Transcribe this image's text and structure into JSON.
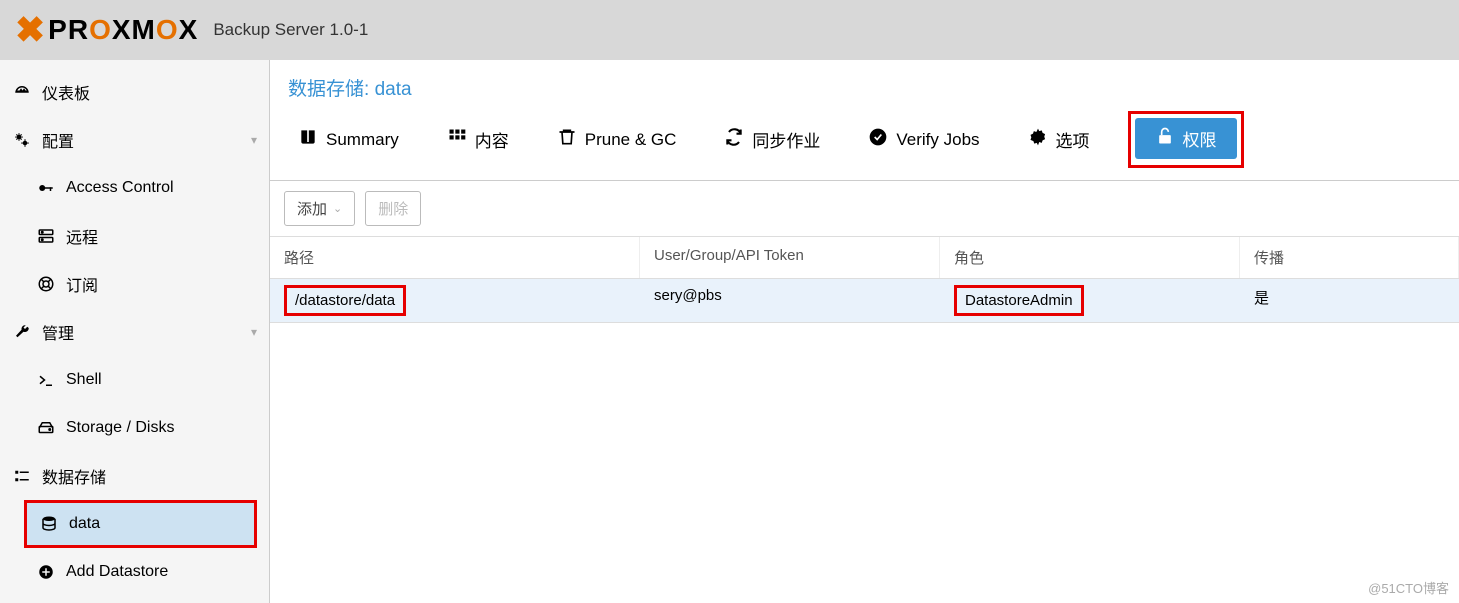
{
  "header": {
    "product": "PROXMOX",
    "subtitle": "Backup Server 1.0-1"
  },
  "sidebar": {
    "items": [
      {
        "label": "仪表板",
        "icon": "dashboard"
      },
      {
        "label": "配置",
        "icon": "gears",
        "expandable": true
      },
      {
        "label": "Access Control",
        "icon": "key",
        "sub": true
      },
      {
        "label": "远程",
        "icon": "server",
        "sub": true
      },
      {
        "label": "订阅",
        "icon": "lifebuoy",
        "sub": true
      },
      {
        "label": "管理",
        "icon": "wrench",
        "expandable": true
      },
      {
        "label": "Shell",
        "icon": "terminal",
        "sub": true
      },
      {
        "label": "Storage / Disks",
        "icon": "hdd",
        "sub": true
      },
      {
        "label": "数据存储",
        "icon": "list"
      },
      {
        "label": "data",
        "icon": "database",
        "sub": true,
        "selected": true,
        "highlight": true
      },
      {
        "label": "Add Datastore",
        "icon": "plus-circle",
        "sub": true
      }
    ]
  },
  "page": {
    "title_prefix": "数据存储: ",
    "title_name": "data"
  },
  "tabs": [
    {
      "label": "Summary",
      "icon": "book"
    },
    {
      "label": "内容",
      "icon": "grid"
    },
    {
      "label": "Prune & GC",
      "icon": "trash"
    },
    {
      "label": "同步作业",
      "icon": "sync"
    },
    {
      "label": "Verify Jobs",
      "icon": "check-circle"
    },
    {
      "label": "选项",
      "icon": "gear"
    },
    {
      "label": "权限",
      "icon": "unlock",
      "active": true,
      "highlight": true
    }
  ],
  "toolbar": {
    "add_label": "添加",
    "remove_label": "删除"
  },
  "table": {
    "columns": {
      "path": "路径",
      "user": "User/Group/API Token",
      "role": "角色",
      "propagate": "传播"
    },
    "rows": [
      {
        "path": "/datastore/data",
        "user": "sery@pbs",
        "role": "DatastoreAdmin",
        "propagate": "是",
        "highlight_path": true,
        "highlight_role": true
      }
    ]
  },
  "watermark": "@51CTO博客"
}
